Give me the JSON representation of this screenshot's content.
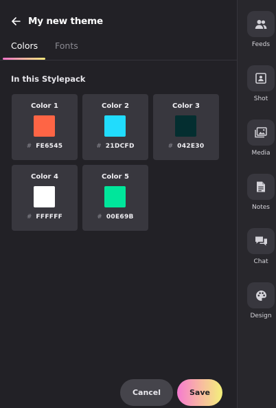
{
  "header": {
    "title": "My new theme",
    "back_icon": "arrow-left-icon"
  },
  "tabs": [
    {
      "label": "Colors",
      "active": true
    },
    {
      "label": "Fonts",
      "active": false
    }
  ],
  "section": {
    "title": "In this Stylepack"
  },
  "colors": [
    {
      "name": "Color 1",
      "hex": "FE6545",
      "color": "#FE6545"
    },
    {
      "name": "Color 2",
      "hex": "21DCFD",
      "color": "#21DCFD"
    },
    {
      "name": "Color 3",
      "hex": "042E30",
      "color": "#042E30"
    },
    {
      "name": "Color 4",
      "hex": "FFFFFF",
      "color": "#FFFFFF"
    },
    {
      "name": "Color 5",
      "hex": "00E69B",
      "color": "#00E69B"
    }
  ],
  "hash_symbol": "#",
  "actions": {
    "cancel_label": "Cancel",
    "save_label": "Save"
  },
  "rail": [
    {
      "label": "Feeds",
      "icon": "people-icon"
    },
    {
      "label": "Shot",
      "icon": "portrait-icon"
    },
    {
      "label": "Media",
      "icon": "images-icon"
    },
    {
      "label": "Notes",
      "icon": "document-icon"
    },
    {
      "label": "Chat",
      "icon": "chat-icon"
    },
    {
      "label": "Design",
      "icon": "palette-icon"
    }
  ],
  "accent_gradient": [
    "#F472C8",
    "#F7B5A2",
    "#F6E77A"
  ]
}
